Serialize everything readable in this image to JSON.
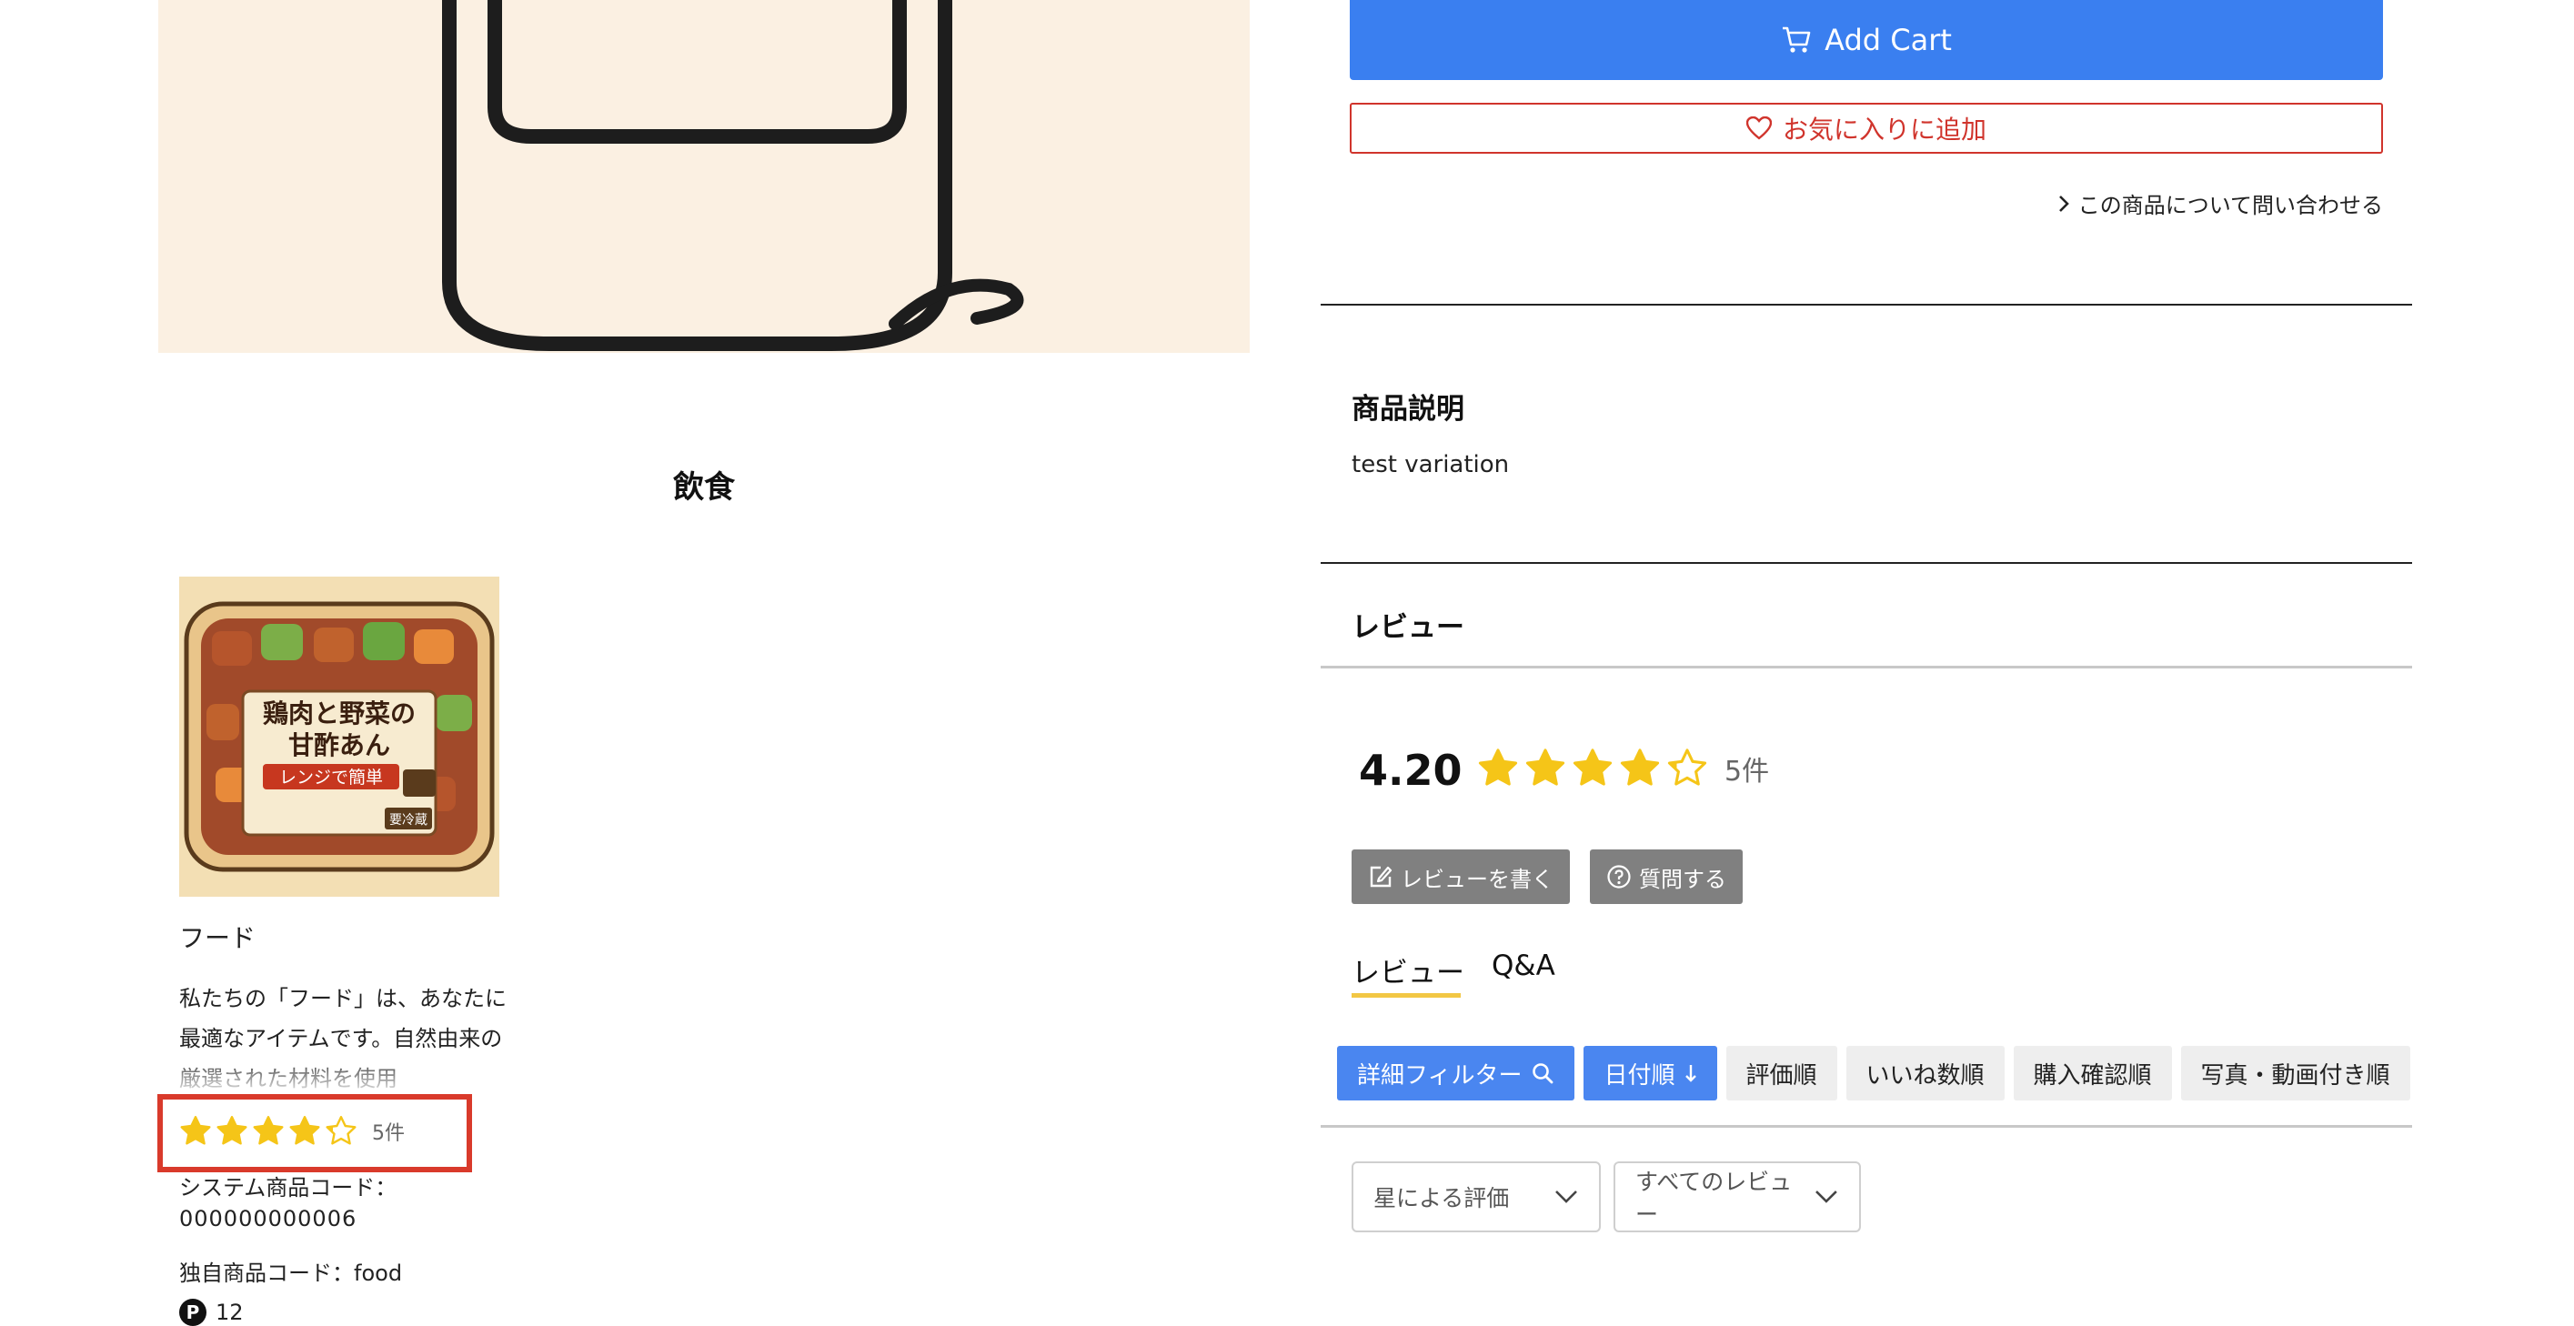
{
  "section_title": "飲食",
  "product_card": {
    "name": "フード",
    "description": "私たちの「フード」は、あなたに最適なアイテムです。自然由来の厳選された材料を使用",
    "rating_fraction": 0.84,
    "review_count": "5件",
    "system_code_label": "システム商品コード：",
    "system_code_value": "000000000006",
    "own_code": "独自商品コード：food",
    "points_badge": "P",
    "points": "12",
    "image": {
      "title_line1": "鶏肉と野菜の",
      "title_line2": "甘酢あん",
      "banner": "レンジで簡単",
      "tag": "要冷蔵"
    }
  },
  "actions": {
    "add_cart": "Add Cart",
    "favorite": "お気に入りに追加",
    "inquiry": "この商品について問い合わせる"
  },
  "description": {
    "heading": "商品説明",
    "text": "test variation"
  },
  "reviews": {
    "heading": "レビュー",
    "average": "4.20",
    "rating_fraction": 0.84,
    "count": "5件",
    "write_review": "レビューを書く",
    "ask_question": "質問する",
    "tabs": [
      "レビュー",
      "Q&A"
    ],
    "filter_button": "詳細フィルター",
    "sort_options": [
      "日付順",
      "評価順",
      "いいね数順",
      "購入確認順",
      "写真・動画付き順"
    ],
    "star_filter": "星による評価",
    "review_filter": "すべてのレビュー"
  },
  "colors": {
    "accent_blue": "#3a7ff0",
    "favorite_red": "#d0342c",
    "star_yellow": "#f5c518",
    "highlight_red": "#d93a2b",
    "tab_underline": "#f2c744"
  }
}
